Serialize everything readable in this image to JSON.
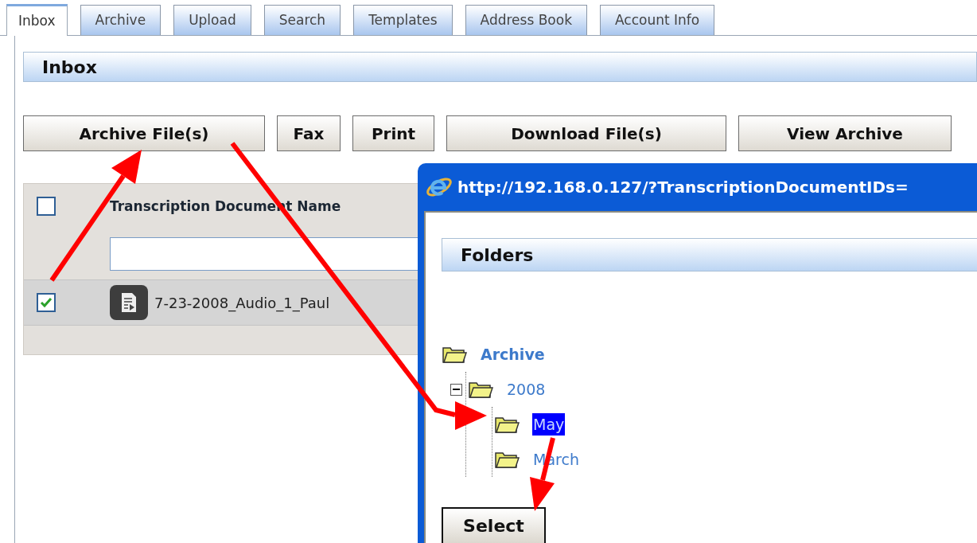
{
  "tabs": [
    {
      "label": "Inbox",
      "selected": true
    },
    {
      "label": "Archive",
      "selected": false
    },
    {
      "label": "Upload",
      "selected": false
    },
    {
      "label": "Search",
      "selected": false
    },
    {
      "label": "Templates",
      "selected": false
    },
    {
      "label": "Address Book",
      "selected": false
    },
    {
      "label": "Account Info",
      "selected": false
    }
  ],
  "panel": {
    "title": "Inbox"
  },
  "toolbar": [
    "Archive File(s)",
    "Fax",
    "Print",
    "Download File(s)",
    "View Archive"
  ],
  "table": {
    "select_all": {
      "checked": false
    },
    "columns": [
      "Transcription Document Name"
    ],
    "rows": [
      {
        "checked": true,
        "name": "7-23-2008_Audio_1_Paul"
      }
    ]
  },
  "popup": {
    "title": "http://192.168.0.127/?TranscriptionDocumentIDs=",
    "header": "Folders",
    "tree": [
      {
        "label": "Archive",
        "selected": false,
        "children": [
          {
            "label": "2008",
            "selected": false,
            "expanded": true,
            "children": [
              {
                "label": "May",
                "selected": true
              },
              {
                "label": "March",
                "selected": false
              }
            ]
          }
        ]
      }
    ],
    "button": "Select"
  }
}
